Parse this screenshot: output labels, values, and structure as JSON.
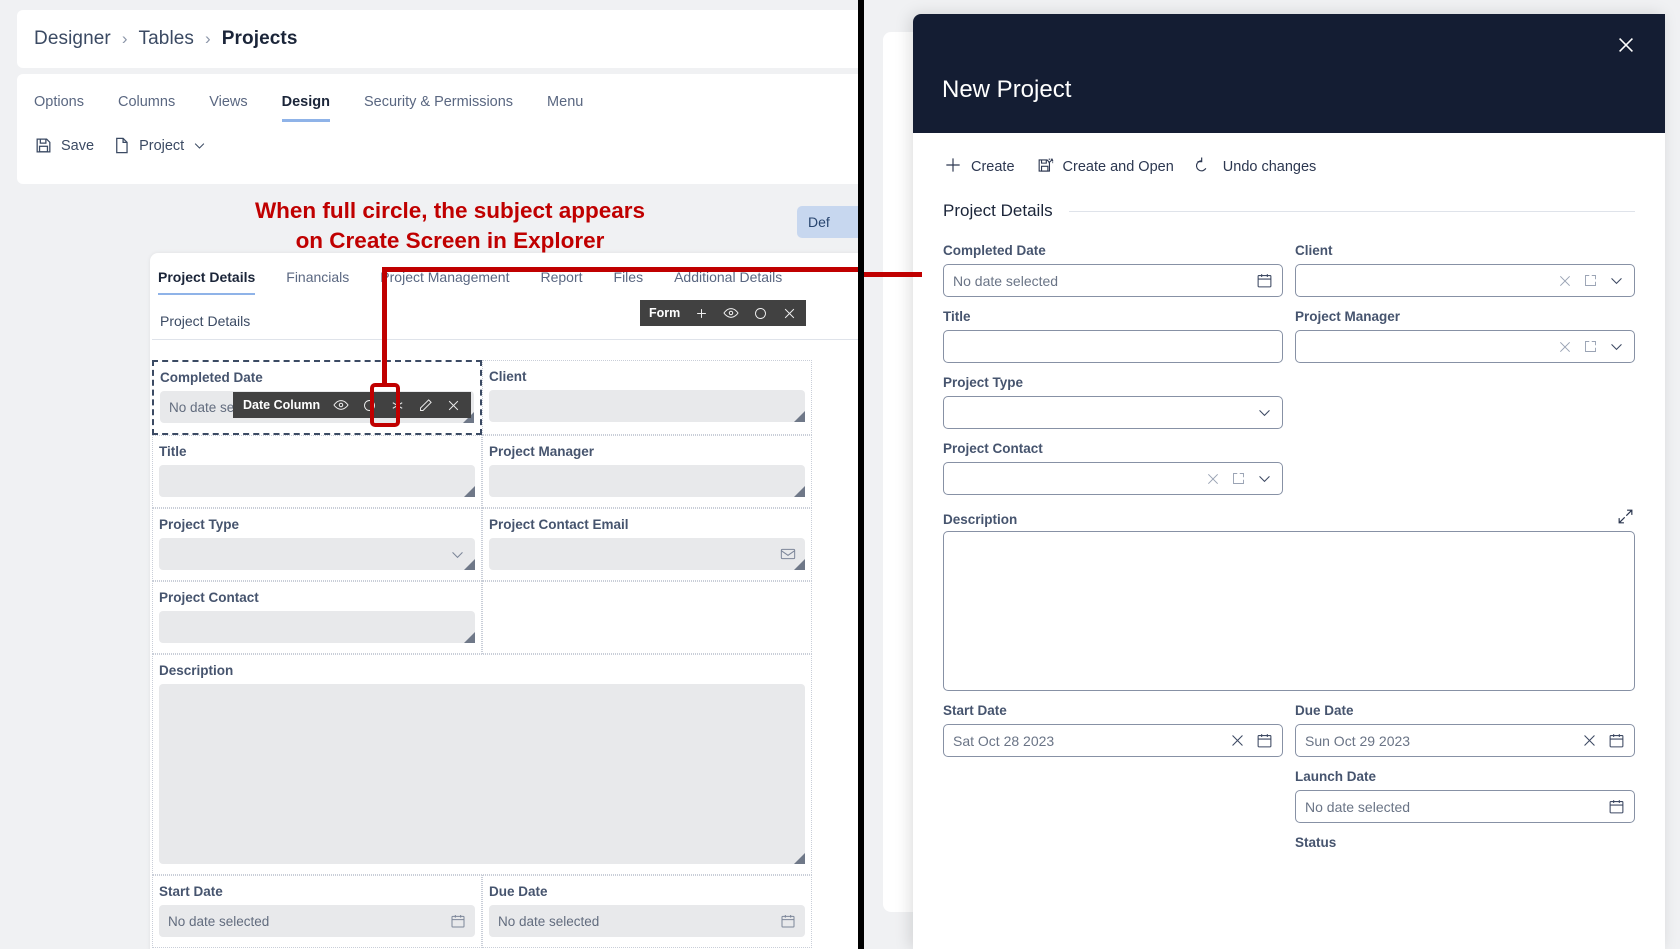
{
  "left": {
    "breadcrumb": [
      "Designer",
      "Tables",
      "Projects"
    ],
    "design_tabs": [
      {
        "label": "Options",
        "active": false
      },
      {
        "label": "Columns",
        "active": false
      },
      {
        "label": "Views",
        "active": false
      },
      {
        "label": "Design",
        "active": true
      },
      {
        "label": "Security & Permissions",
        "active": false
      },
      {
        "label": "Menu",
        "active": false
      }
    ],
    "toolbar": {
      "save_label": "Save",
      "project_label": "Project"
    },
    "annotation": {
      "line1": "When full circle, the subject appears",
      "line2": "on Create Screen in Explorer",
      "color": "#c00000"
    },
    "def_button_label": "Def",
    "form_tabs": [
      {
        "label": "Project Details",
        "active": true
      },
      {
        "label": "Financials",
        "active": false
      },
      {
        "label": "Project Management",
        "active": false
      },
      {
        "label": "Report",
        "active": false
      },
      {
        "label": "Files",
        "active": false
      },
      {
        "label": "Additional Details",
        "active": false
      }
    ],
    "form_section_title": "Project Details",
    "form_pill": {
      "label": "Form",
      "icons": [
        "plus-icon",
        "eye-icon",
        "circle-icon",
        "close-icon"
      ]
    },
    "tooltip": {
      "label": "Date Column",
      "icons": [
        "eye-icon",
        "circle-icon",
        "asterisk-icon",
        "pencil-icon",
        "close-icon"
      ]
    },
    "designer_fields": {
      "completed_date": {
        "label": "Completed Date",
        "value": "No date selected",
        "icon": "calendar-icon"
      },
      "client": {
        "label": "Client",
        "value": ""
      },
      "title": {
        "label": "Title",
        "value": ""
      },
      "project_manager": {
        "label": "Project Manager",
        "value": ""
      },
      "project_type": {
        "label": "Project Type",
        "value": "",
        "icon": "chevron-down-icon"
      },
      "project_contact_email": {
        "label": "Project Contact Email",
        "value": "",
        "icon": "envelope-icon"
      },
      "project_contact": {
        "label": "Project Contact",
        "value": ""
      },
      "description": {
        "label": "Description",
        "value": ""
      },
      "start_date": {
        "label": "Start Date",
        "value": "No date selected",
        "icon": "calendar-icon"
      },
      "due_date": {
        "label": "Due Date",
        "value": "No date selected",
        "icon": "calendar-icon"
      }
    }
  },
  "right": {
    "modal_title": "New Project",
    "close_icon": "close-icon",
    "actions": [
      {
        "label": "Create",
        "icon": "plus-icon"
      },
      {
        "label": "Create and Open",
        "icon": "save-open-icon"
      },
      {
        "label": "Undo changes",
        "icon": "undo-icon"
      }
    ],
    "section_title": "Project Details",
    "fields": {
      "completed_date": {
        "label": "Completed Date",
        "value": "No date selected"
      },
      "client": {
        "label": "Client",
        "value": ""
      },
      "title": {
        "label": "Title",
        "value": ""
      },
      "project_manager": {
        "label": "Project Manager",
        "value": ""
      },
      "project_type": {
        "label": "Project Type",
        "value": ""
      },
      "project_contact": {
        "label": "Project Contact",
        "value": ""
      },
      "description": {
        "label": "Description",
        "value": ""
      },
      "start_date": {
        "label": "Start Date",
        "value": "Sat Oct 28 2023"
      },
      "due_date": {
        "label": "Due Date",
        "value": "Sun Oct 29 2023"
      },
      "launch_date": {
        "label": "Launch Date",
        "value": "No date selected"
      },
      "status": {
        "label": "Status",
        "value": ""
      }
    }
  },
  "colors": {
    "modal_header": "#141d33",
    "annotation_red": "#c00000",
    "accent_blue": "#8fb3e8",
    "field_bg": "#e8e9eb"
  }
}
